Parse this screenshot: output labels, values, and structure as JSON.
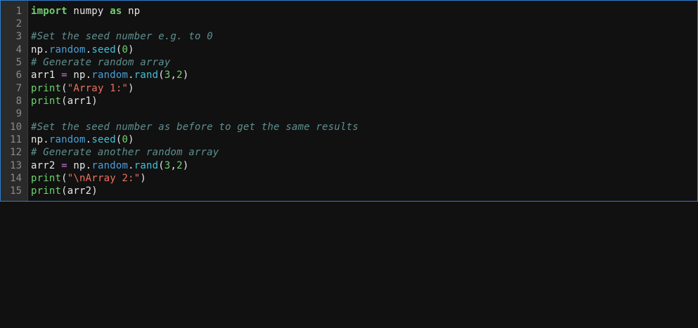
{
  "editor": {
    "line_numbers": [
      "1",
      "2",
      "3",
      "4",
      "5",
      "6",
      "7",
      "8",
      "9",
      "10",
      "11",
      "12",
      "13",
      "14",
      "15"
    ],
    "lines": [
      [
        {
          "t": "import",
          "c": "kw"
        },
        {
          "t": " numpy ",
          "c": ""
        },
        {
          "t": "as",
          "c": "kw"
        },
        {
          "t": " np",
          "c": ""
        }
      ],
      [],
      [
        {
          "t": "#Set the seed number e.g. to 0",
          "c": "cm"
        }
      ],
      [
        {
          "t": "np.",
          "c": ""
        },
        {
          "t": "random",
          "c": "attr"
        },
        {
          "t": ".",
          "c": ""
        },
        {
          "t": "seed",
          "c": "fn"
        },
        {
          "t": "(",
          "c": ""
        },
        {
          "t": "0",
          "c": "num"
        },
        {
          "t": ")",
          "c": ""
        }
      ],
      [
        {
          "t": "# Generate random array",
          "c": "cm"
        }
      ],
      [
        {
          "t": "arr1 ",
          "c": ""
        },
        {
          "t": "=",
          "c": "op"
        },
        {
          "t": " np.",
          "c": ""
        },
        {
          "t": "random",
          "c": "attr"
        },
        {
          "t": ".",
          "c": ""
        },
        {
          "t": "rand",
          "c": "fn"
        },
        {
          "t": "(",
          "c": ""
        },
        {
          "t": "3",
          "c": "num"
        },
        {
          "t": ",",
          "c": ""
        },
        {
          "t": "2",
          "c": "num"
        },
        {
          "t": ")",
          "c": ""
        }
      ],
      [
        {
          "t": "print",
          "c": "bi"
        },
        {
          "t": "(",
          "c": ""
        },
        {
          "t": "\"Array 1:\"",
          "c": "str"
        },
        {
          "t": ")",
          "c": ""
        }
      ],
      [
        {
          "t": "print",
          "c": "bi"
        },
        {
          "t": "(arr1)",
          "c": ""
        }
      ],
      [],
      [
        {
          "t": "#Set the seed number as before to get the same results",
          "c": "cm"
        }
      ],
      [
        {
          "t": "np.",
          "c": ""
        },
        {
          "t": "random",
          "c": "attr"
        },
        {
          "t": ".",
          "c": ""
        },
        {
          "t": "seed",
          "c": "fn"
        },
        {
          "t": "(",
          "c": ""
        },
        {
          "t": "0",
          "c": "num"
        },
        {
          "t": ")",
          "c": ""
        }
      ],
      [
        {
          "t": "# Generate another random array",
          "c": "cm"
        }
      ],
      [
        {
          "t": "arr2 ",
          "c": ""
        },
        {
          "t": "=",
          "c": "op"
        },
        {
          "t": " np.",
          "c": ""
        },
        {
          "t": "random",
          "c": "attr"
        },
        {
          "t": ".",
          "c": ""
        },
        {
          "t": "rand",
          "c": "fn"
        },
        {
          "t": "(",
          "c": ""
        },
        {
          "t": "3",
          "c": "num"
        },
        {
          "t": ",",
          "c": ""
        },
        {
          "t": "2",
          "c": "num"
        },
        {
          "t": ")",
          "c": ""
        }
      ],
      [
        {
          "t": "print",
          "c": "bi"
        },
        {
          "t": "(",
          "c": ""
        },
        {
          "t": "\"\\nArray 2:\"",
          "c": "str"
        },
        {
          "t": ")",
          "c": ""
        }
      ],
      [
        {
          "t": "print",
          "c": "bi"
        },
        {
          "t": "(arr2)",
          "c": ""
        }
      ]
    ]
  },
  "colors": {
    "background": "#111111",
    "gutter": "#2a2a2a",
    "focus_border": "#2e7fd0",
    "keyword": "#6fd16f",
    "comment": "#5f8f8f",
    "string": "#f07060",
    "operator": "#c678dd",
    "attribute": "#4a9ed8",
    "function": "#3fc1d9"
  }
}
